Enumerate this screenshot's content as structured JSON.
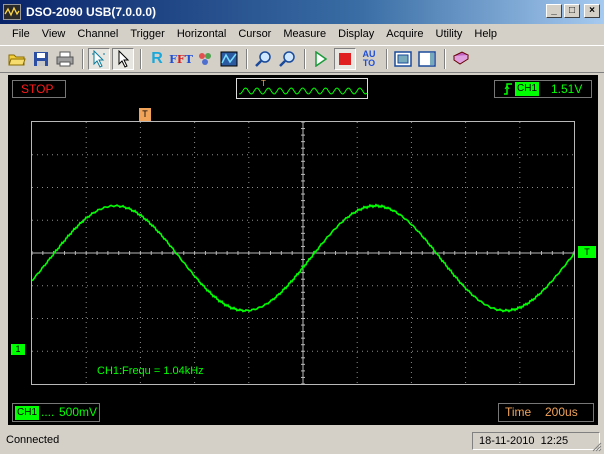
{
  "window": {
    "title": "DSO-2090 USB(7.0.0.0)",
    "min_glyph": "_",
    "max_glyph": "□",
    "close_glyph": "×"
  },
  "menu": [
    "File",
    "View",
    "Channel",
    "Trigger",
    "Horizontal",
    "Cursor",
    "Measure",
    "Display",
    "Acquire",
    "Utility",
    "Help"
  ],
  "toolbar": {
    "buttons": [
      {
        "name": "open-icon",
        "glyph": "📂"
      },
      {
        "name": "save-icon",
        "glyph": "💾"
      },
      {
        "name": "print-icon",
        "glyph": "🖶"
      },
      {
        "name": "cursor-select-icon",
        "glyph": "↖"
      },
      {
        "name": "pointer-icon",
        "glyph": "↖"
      },
      {
        "name": "reference-icon",
        "glyph": "R"
      },
      {
        "name": "fft-icon",
        "glyph": "F"
      },
      {
        "name": "color-palette-icon",
        "glyph": "✿"
      },
      {
        "name": "waveform-icon",
        "glyph": "▦"
      },
      {
        "name": "zoom-in-icon",
        "glyph": "🔍"
      },
      {
        "name": "zoom-out-icon",
        "glyph": "🔍"
      },
      {
        "name": "run-icon",
        "glyph": "▷"
      },
      {
        "name": "stop-icon",
        "glyph": "■"
      },
      {
        "name": "auto-set-icon",
        "glyph": "AU TO"
      },
      {
        "name": "fullscreen-icon",
        "glyph": "▣"
      },
      {
        "name": "panel-icon",
        "glyph": "▤"
      },
      {
        "name": "book-icon",
        "glyph": "📕"
      }
    ]
  },
  "scope": {
    "run_state": "STOP",
    "trigger_channel": "CH1",
    "trigger_level": "1.51V",
    "trigger_marker": "T",
    "channel_marker": "1",
    "trigger_level_marker": "T",
    "frequency_readout": "CH1:Frequ = 1.04kHz",
    "volts_channel": "CH1",
    "volts_coupling": "....",
    "volts_per_div": "500mV",
    "time_label": "Time",
    "time_per_div": "200us",
    "colors": {
      "trace": "#00ff00",
      "background": "#000000",
      "stop": "#ff1a1a",
      "trigger_marker": "#f2a35a"
    }
  },
  "statusbar": {
    "text": "Connected",
    "date": "18-11-2010",
    "time": "12:25"
  }
}
